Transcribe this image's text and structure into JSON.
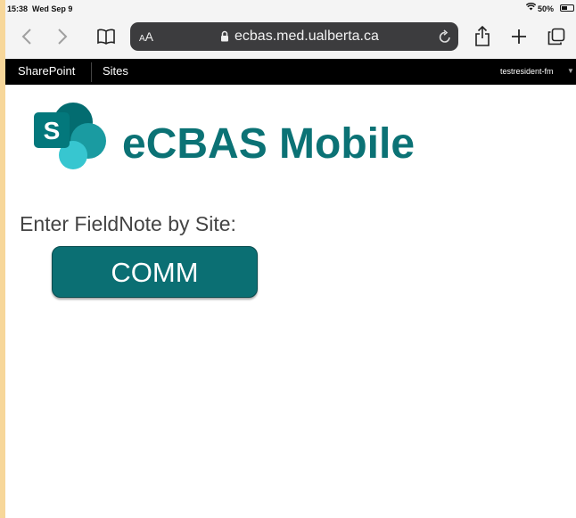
{
  "status_bar": {
    "time": "15:38",
    "date": "Wed Sep 9",
    "battery_pct": "50%",
    "battery_level": 0.5
  },
  "browser": {
    "text_size_label": "AA",
    "url_host": "ecbas.med.ualberta.ca"
  },
  "sharepoint_bar": {
    "items": [
      {
        "label": "SharePoint"
      },
      {
        "label": "Sites"
      }
    ],
    "user": "testresident-fm"
  },
  "page": {
    "title": "eCBAS Mobile",
    "prompt": "Enter FieldNote by Site:",
    "site_button": "COMM"
  },
  "colors": {
    "brand_teal": "#0b7275",
    "button_teal": "#0b6f73"
  }
}
